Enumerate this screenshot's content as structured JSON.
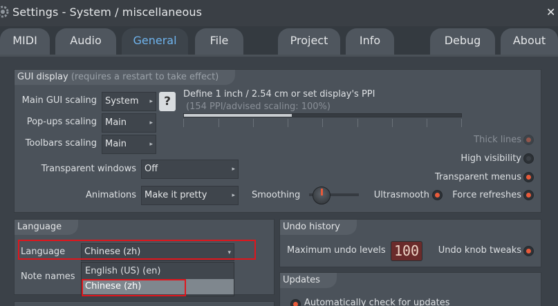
{
  "window": {
    "title": "Settings - System / miscellaneous",
    "close": "✕"
  },
  "tabs": [
    {
      "label": "MIDI"
    },
    {
      "label": "Audio"
    },
    {
      "label": "General",
      "active": true
    },
    {
      "label": "File"
    },
    {
      "label": "Project"
    },
    {
      "label": "Info"
    },
    {
      "label": "Debug"
    },
    {
      "label": "About"
    }
  ],
  "gui": {
    "header": "GUI display",
    "header_note": "(requires a restart to take effect)",
    "main_scaling_label": "Main GUI scaling",
    "main_scaling_value": "System",
    "help": "?",
    "popups_label": "Pop-ups scaling",
    "popups_value": "Main",
    "toolbars_label": "Toolbars scaling",
    "toolbars_value": "Main",
    "ppi_title": "Define 1 inch / 2.54 cm or set display's PPI",
    "ppi_info": "(154 PPI/advised scaling: 100%)",
    "ppi_fill": 0.39,
    "transparent_label": "Transparent windows",
    "transparent_value": "Off",
    "animations_label": "Animations",
    "animations_value": "Make it pretty",
    "smoothing_label": "Smoothing",
    "thick_lines": "Thick lines",
    "high_visibility": "High visibility",
    "transparent_menus": "Transparent menus",
    "ultrasmooth": "Ultrasmooth",
    "force_refreshes": "Force refreshes"
  },
  "language": {
    "header": "Language",
    "label": "Language",
    "value": "Chinese (zh)",
    "note_names_label": "Note names",
    "options": [
      "English (US) (en)",
      "Chinese (zh)"
    ]
  },
  "undo": {
    "header": "Undo history",
    "max_label": "Maximum undo levels",
    "max_value": "100",
    "knob_tweaks": "Undo knob tweaks"
  },
  "updates": {
    "header": "Updates",
    "auto_check": "Automatically check for updates"
  },
  "colors": {
    "accent": "#6fb4ee",
    "radio_on": "#e85a3a",
    "highlight": "#e0151c"
  }
}
